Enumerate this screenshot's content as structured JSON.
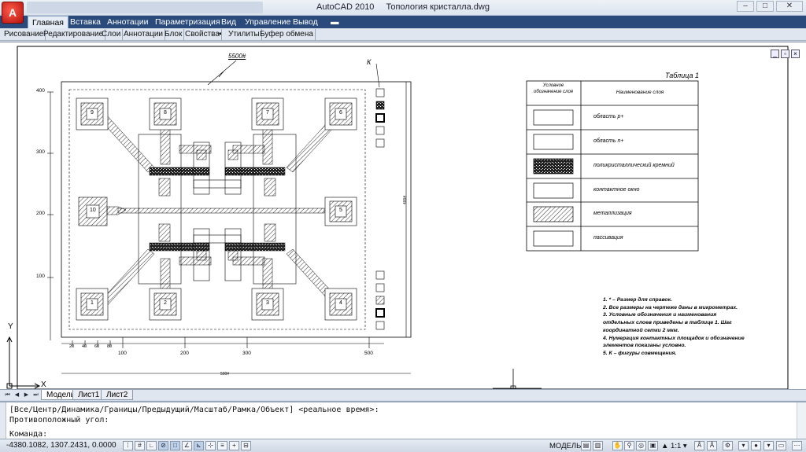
{
  "app": {
    "name": "AutoCAD 2010",
    "file": "Топология кристалла.dwg",
    "logo_letter": "A"
  },
  "ribbon": {
    "tabs": [
      "Главная",
      "Вставка",
      "Аннотации",
      "Параметризация",
      "Вид",
      "Управление",
      "Вывод"
    ],
    "extra_icon": "ribbon-toggle-icon"
  },
  "panels": [
    "Рисование",
    "Редактирование",
    "Слои",
    "Аннотации",
    "Блок",
    "Свойства",
    "Утилиты",
    "Буфер обмена"
  ],
  "drawing": {
    "dim_top": "5500#",
    "dim_k": "К",
    "dim_bottom": "500#",
    "dim_right": "400#",
    "y_ticks": [
      "400",
      "300",
      "200",
      "100"
    ],
    "x_ticks_small": [
      "20",
      "40",
      "60",
      "80"
    ],
    "x_ticks": [
      "100",
      "200",
      "300",
      "500"
    ],
    "pad_numbers": [
      "9",
      "8",
      "7",
      "6",
      "10",
      "5",
      "1",
      "2",
      "3",
      "4"
    ],
    "table": {
      "title": "Таблица 1",
      "col1_header": "Условное обозначение слоя",
      "col2_header": "Наименование слоя",
      "rows": [
        "область p+",
        "область n+",
        "поликристаллический кремний",
        "контактное окно",
        "металлизация",
        "пассивация"
      ]
    },
    "notes": [
      "1. * – Размер для справок.",
      "2. Все размеры на чертеже даны в микрометрах.",
      "3. Условные обозначения и наименования",
      "отдельных слоев приведены в таблице 1. Шаг",
      "координатной сетки 2 мкм.",
      "4. Нумерация контактных площадок и обозначение",
      "элементов показаны условно.",
      "5. К – фигуры совмещения."
    ],
    "ucs_y": "Y",
    "ucs_x": "X"
  },
  "layout_tabs": [
    "Модель",
    "Лист1",
    "Лист2"
  ],
  "command": {
    "line1": "[Все/Центр/Динамика/Границы/Предыдущий/Масштаб/Рамка/Объект] <реальное время>:",
    "line2": "Противоположный угол:",
    "prompt": "Команда:",
    "input_value": ""
  },
  "status": {
    "coords": "-4380.1082, 1307.2431, 0.0000",
    "model_label": "МОДЕЛЬ",
    "scale_label": "1:1"
  },
  "colors": {
    "ribbon_bg": "#294a7a",
    "logo_red": "#b4120e"
  }
}
